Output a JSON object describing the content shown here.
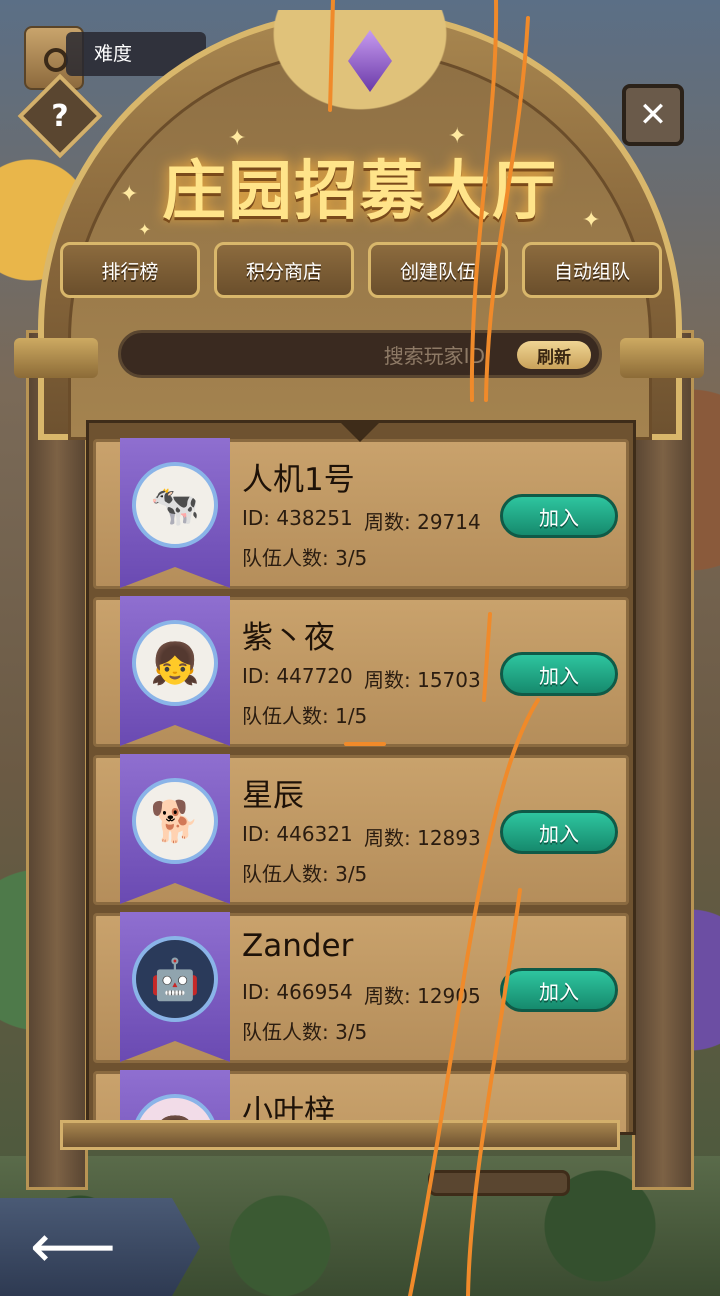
{
  "header": {
    "difficulty_label": "难度",
    "title": "庄园招募大厅",
    "help_icon_text": "?",
    "close_icon_text": "✕"
  },
  "tabs": [
    {
      "label": "排行榜"
    },
    {
      "label": "积分商店"
    },
    {
      "label": "创建队伍"
    },
    {
      "label": "自动组队"
    }
  ],
  "search": {
    "placeholder": "搜索玩家ID",
    "refresh_label": "刷新"
  },
  "players": [
    {
      "name": "人机1号",
      "id": "ID: 438251",
      "week": "周数: 29714",
      "team": "队伍人数: 3/5",
      "join": "加入",
      "avatar_icon": "cow-avatar-icon"
    },
    {
      "name": "紫丶夜",
      "id": "ID: 447720",
      "week": "周数: 15703",
      "team": "队伍人数: 1/5",
      "join": "加入",
      "avatar_icon": "anime-girl-avatar-icon"
    },
    {
      "name": "星辰",
      "id": "ID: 446321",
      "week": "周数: 12893",
      "team": "队伍人数: 3/5",
      "join": "加入",
      "avatar_icon": "shiba-avatar-icon"
    },
    {
      "name": "Zander",
      "id": "ID: 466954",
      "week": "周数: 12905",
      "team": "队伍人数: 3/5",
      "join": "加入",
      "avatar_icon": "robot-avatar-icon"
    },
    {
      "name": "小叶梓",
      "id": "",
      "week": "",
      "team": "",
      "join": "",
      "avatar_icon": "pink-hair-avatar-icon"
    }
  ],
  "footer": {
    "back_icon": "back-arrow-icon",
    "back_glyph": "⟵"
  },
  "colors": {
    "title_gold": "#ffe48a",
    "join_teal": "#2ec59f",
    "banner_purple": "#7a5ac4",
    "annotation_orange": "#f08a2a"
  }
}
